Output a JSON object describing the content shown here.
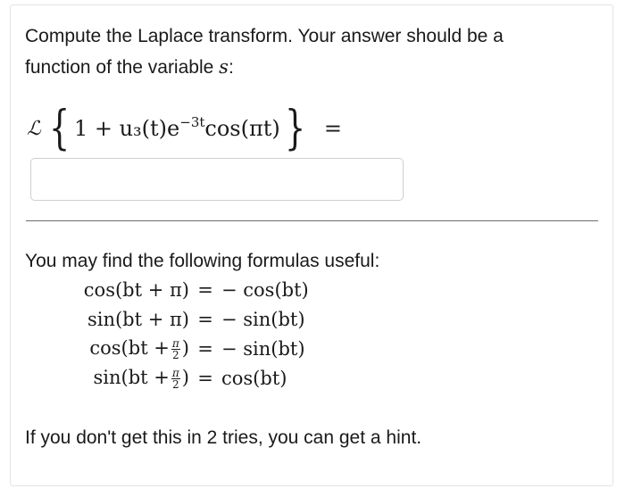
{
  "question": {
    "prompt_line1": "Compute the Laplace transform. Your answer should be a",
    "prompt_line2_prefix": "function of the variable",
    "variable": "s",
    "prompt_line2_suffix": ":",
    "laplace_symbol": "ℒ",
    "expression_main": "1 + u₃(t)e",
    "expression_exponent": "−3t",
    "expression_tail": " cos(πt)",
    "equals": "="
  },
  "answer_input": {
    "value": "",
    "placeholder": ""
  },
  "formulas": {
    "intro": "You may find the following formulas useful:",
    "rows": [
      {
        "lhs": "cos(bt + π)",
        "eq": "=",
        "rhs": "− cos(bt)"
      },
      {
        "lhs": "sin(bt + π)",
        "eq": "=",
        "rhs": "− sin(bt)"
      },
      {
        "lhs_pre": "cos(bt +",
        "frac_num": "π",
        "frac_den": "2",
        "lhs_post": ")",
        "eq": "=",
        "rhs": "− sin(bt)"
      },
      {
        "lhs_pre": "sin(bt +",
        "frac_num": "π",
        "frac_den": "2",
        "lhs_post": ")",
        "eq": "=",
        "rhs": "cos(bt)"
      }
    ]
  },
  "hint_text": "If you don't get this in 2 tries, you can get a hint."
}
